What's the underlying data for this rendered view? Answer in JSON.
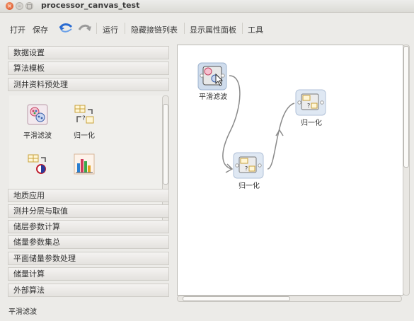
{
  "window": {
    "title": "processor_canvas_test"
  },
  "toolbar": {
    "open": "打开",
    "save": "保存",
    "run": "运行",
    "hide_links": "隐藏接链列表",
    "show_props": "显示属性面板",
    "tools": "工具",
    "undo_icon": "undo-arrow-icon",
    "redo_icon": "redo-arrow-icon"
  },
  "sections_top": [
    "数据设置",
    "算法模板",
    "测井资料预处理"
  ],
  "palette": {
    "items": [
      {
        "label": "平滑滤波",
        "icon": "smooth-filter-icon"
      },
      {
        "label": "归一化",
        "icon": "normalize-icon"
      },
      {
        "label": "",
        "icon": "normalize-variant-icon"
      },
      {
        "label": "",
        "icon": "bar-chart-icon"
      }
    ]
  },
  "sections_bottom": [
    "地质应用",
    "测井分层与取值",
    "储层参数计算",
    "储量参数集总",
    "平面储量参数处理",
    "储量计算",
    "外部算法"
  ],
  "canvas": {
    "nodes": [
      {
        "label": "平滑滤波",
        "icon": "smooth-filter-icon",
        "selected": true
      },
      {
        "label": "归一化",
        "icon": "normalize-icon"
      },
      {
        "label": "归一化",
        "icon": "normalize-icon"
      }
    ],
    "links": [
      {
        "from": 0,
        "to": 1
      },
      {
        "from": 1,
        "to": 2
      }
    ]
  },
  "status": {
    "text": "平滑滤波"
  },
  "colors": {
    "accent_close": "#e0582a",
    "node_selected_bg": "#cfdcec",
    "link": "#8a8a8a"
  }
}
